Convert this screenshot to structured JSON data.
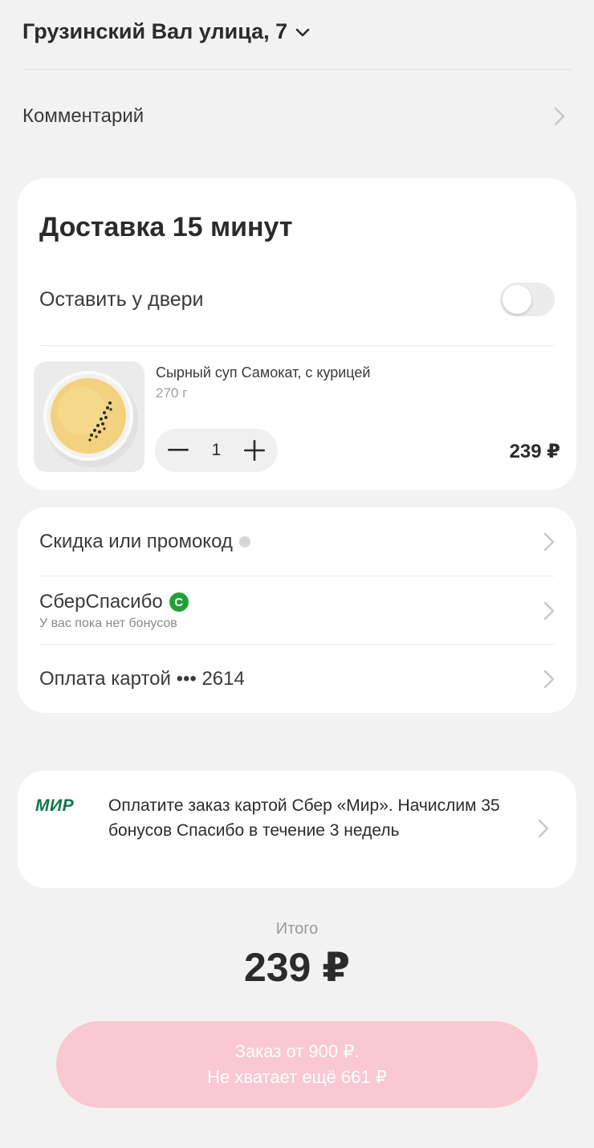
{
  "header": {
    "address": "Грузинский Вал улица, 7",
    "comment_label": "Комментарий"
  },
  "delivery": {
    "title": "Доставка 15 минут",
    "leave_at_door_label": "Оставить у двери",
    "leave_at_door_enabled": false
  },
  "product": {
    "name": "Сырный суп Самокат, с курицей",
    "weight": "270 г",
    "quantity": "1",
    "price": "239 ₽"
  },
  "payment": {
    "promo_label": "Скидка или промокод",
    "sber_label": "СберСпасибо",
    "sber_badge": "С",
    "sber_sublabel": "У вас пока нет бонусов",
    "card_label": "Оплата картой ••• 2614"
  },
  "mir_promo": {
    "logo": "МИР",
    "text": "Оплатите заказ картой Сбер «Мир». Начислим 35 бонусов Спасибо в течение 3 недель"
  },
  "total": {
    "label": "Итого",
    "value": "239 ₽"
  },
  "order_button": {
    "line1": "Заказ от 900 ₽.",
    "line2": "Не хватает ещё 661 ₽"
  },
  "colors": {
    "background": "#f2f2f2",
    "card": "#ffffff",
    "button_disabled": "#f9c8d3",
    "sber_green": "#21a038",
    "mir_green": "#0f754e"
  }
}
